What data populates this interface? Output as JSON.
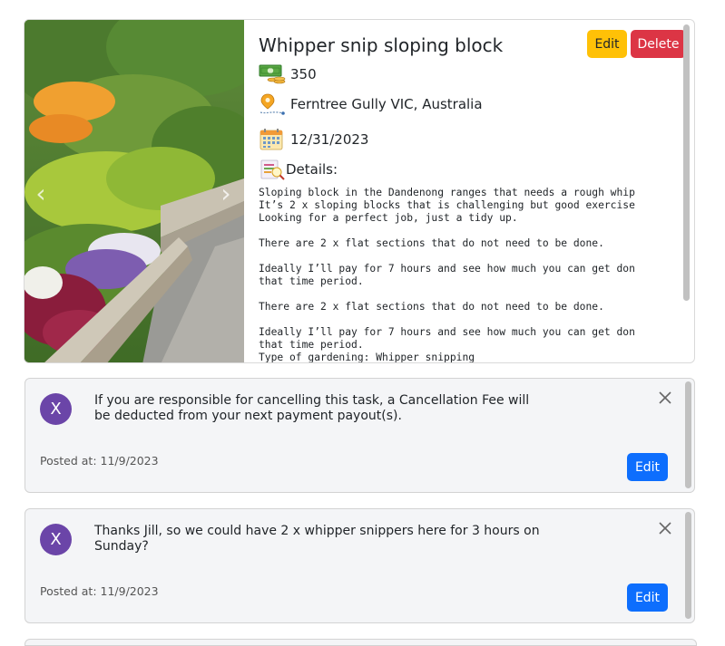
{
  "task": {
    "title": "Whipper snip sloping block",
    "edit_label": "Edit",
    "delete_label": "Delete",
    "price": "350",
    "location": "Ferntree Gully VIC, Australia",
    "date": "12/31/2023",
    "details_label": "Details:",
    "details_text": "Sloping block in the Dandenong ranges that needs a rough whip\nIt’s 2 x sloping blocks that is challenging but good exercise\nLooking for a perfect job, just a tidy up.\n\nThere are 2 x flat sections that do not need to be done.\n\nIdeally I’ll pay for 7 hours and see how much you can get don\nthat time period.\n\nThere are 2 x flat sections that do not need to be done.\n\nIdeally I’ll pay for 7 hours and see how much you can get don\nthat time period.\nType of gardening: Whipper snipping",
    "carousel_prev": "‹",
    "carousel_next": "›"
  },
  "comments": [
    {
      "avatar_letter": "X",
      "text": "If you are responsible for cancelling this task, a Cancellation Fee will be deducted from your next payment payout(s).",
      "posted": "Posted at: 11/9/2023",
      "edit_label": "Edit"
    },
    {
      "avatar_letter": "X",
      "text": "Thanks Jill, so we could have 2 x whipper snippers here for 3 hours on Sunday?",
      "posted": "Posted at: 11/9/2023",
      "edit_label": "Edit"
    }
  ],
  "colors": {
    "edit_yellow": "#ffc107",
    "delete_red": "#dc3545",
    "edit_blue": "#0d6efd",
    "avatar_purple": "#6b45a8"
  },
  "icons": {
    "price": "money-icon",
    "location": "location-pin-icon",
    "date": "calendar-icon",
    "details": "details-icon",
    "close": "close-icon"
  }
}
